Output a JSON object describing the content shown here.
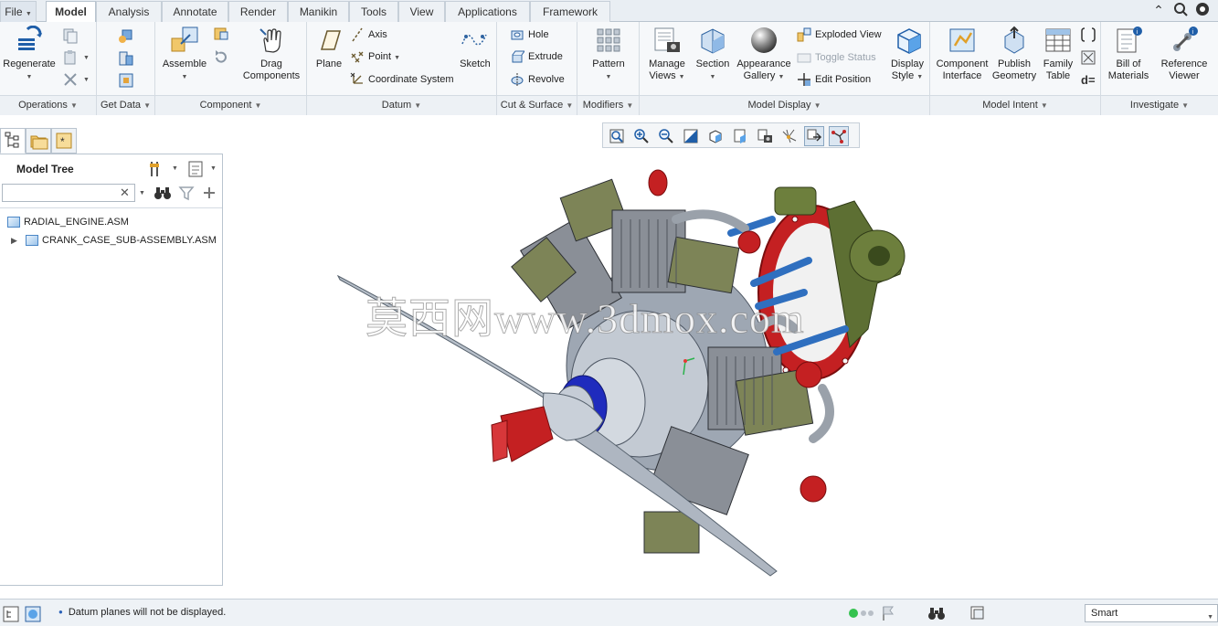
{
  "tabs": [
    {
      "label": "File"
    },
    {
      "label": "Model"
    },
    {
      "label": "Analysis"
    },
    {
      "label": "Annotate"
    },
    {
      "label": "Render"
    },
    {
      "label": "Manikin"
    },
    {
      "label": "Tools"
    },
    {
      "label": "View"
    },
    {
      "label": "Applications"
    },
    {
      "label": "Framework"
    }
  ],
  "ribbon": {
    "operations": {
      "regenerate": "Regenerate",
      "footer": "Operations"
    },
    "get_data": {
      "footer": "Get Data"
    },
    "component": {
      "assemble": "Assemble",
      "drag_components": "Drag Components",
      "footer": "Component"
    },
    "datum": {
      "plane": "Plane",
      "axis": "Axis",
      "point": "Point",
      "coordinate_system": "Coordinate System",
      "sketch": "Sketch",
      "footer": "Datum"
    },
    "cut_surface": {
      "hole": "Hole",
      "extrude": "Extrude",
      "revolve": "Revolve",
      "footer": "Cut & Surface"
    },
    "modifiers": {
      "pattern": "Pattern",
      "footer": "Modifiers"
    },
    "model_display": {
      "manage_views": "Manage Views",
      "section": "Section",
      "appearance_gallery": "Appearance Gallery",
      "exploded_view": "Exploded View",
      "toggle_status": "Toggle Status",
      "edit_position": "Edit Position",
      "display_style": "Display Style",
      "footer": "Model Display"
    },
    "model_intent": {
      "component_interface": "Component Interface",
      "publish_geometry": "Publish Geometry",
      "family_table": "Family Table",
      "footer": "Model Intent"
    },
    "investigate": {
      "bill_of_materials": "Bill of Materials",
      "reference_viewer": "Reference Viewer",
      "footer": "Investigate"
    }
  },
  "model_tree": {
    "title": "Model Tree",
    "search_value": "",
    "items": [
      {
        "label": "RADIAL_ENGINE.ASM"
      },
      {
        "label": "CRANK_CASE_SUB-ASSEMBLY.ASM"
      }
    ]
  },
  "viewport": {
    "watermark": "莫西网www.3dmox.com"
  },
  "status": {
    "message": "Datum planes will not be displayed.",
    "filter": "Smart"
  },
  "colors": {
    "accent": "#2a62b8",
    "ribbon_bg": "#f6f8fa"
  }
}
